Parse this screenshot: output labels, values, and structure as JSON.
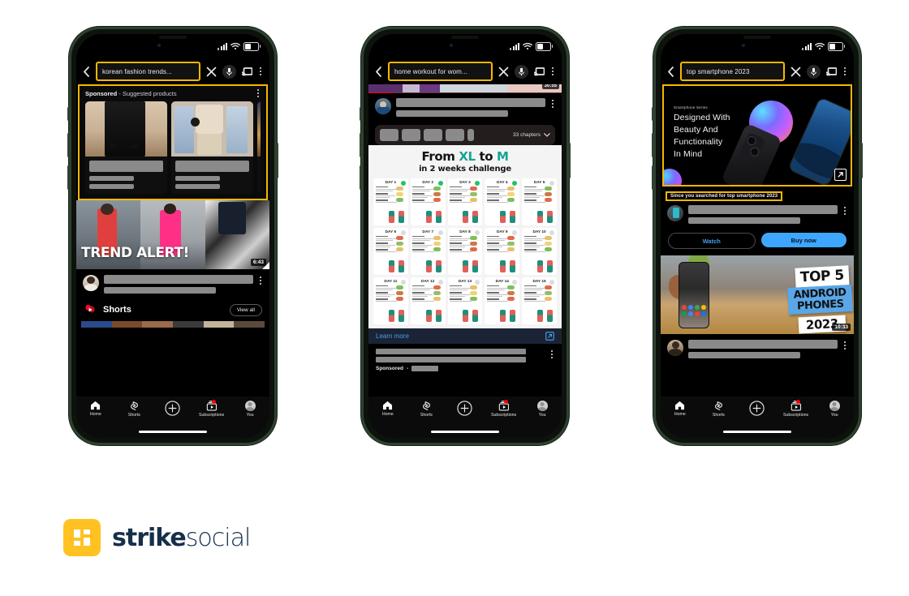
{
  "page": {
    "background": "#ffffff",
    "highlight_color": "#F5B800",
    "brand_navy": "#16304a",
    "brand_yellow": "#FFC222"
  },
  "brand": {
    "logo_mark": "strike-social-mark",
    "name_bold": "strike",
    "name_light": "social"
  },
  "phones": [
    {
      "id": "phone-korean-fashion",
      "status": {
        "signal": "signal-icon",
        "wifi": "wifi-icon",
        "battery": "battery-icon"
      },
      "search": {
        "query": "korean fashion trends...",
        "back_icon": "back-arrow-icon",
        "clear_icon": "close-icon",
        "mic_icon": "microphone-icon",
        "cast_icon": "cast-icon",
        "more_icon": "more-vertical-icon"
      },
      "sponsored": {
        "label": "Sponsored",
        "separator": "-",
        "subtitle": "Suggested products",
        "more_icon": "more-vertical-icon",
        "products": [
          {
            "alt": "black wide-leg pants outfit"
          },
          {
            "alt": "beige sweater and denim jeans set"
          },
          {
            "alt": "third product partially visible"
          }
        ]
      },
      "video": {
        "overlay_text": "TREND ALERT!",
        "duration": "6:43",
        "avatar": "channel-avatar",
        "more_icon": "more-vertical-icon"
      },
      "shorts": {
        "icon": "shorts-logo-icon",
        "title": "Shorts",
        "view_all": "View all"
      },
      "nav": [
        {
          "icon": "home-icon",
          "label": "Home"
        },
        {
          "icon": "shorts-icon",
          "label": "Shorts"
        },
        {
          "icon": "plus-circle-icon",
          "label": ""
        },
        {
          "icon": "subscriptions-icon",
          "label": "Subscriptions",
          "badge": true
        },
        {
          "icon": "account-avatar-icon",
          "label": "You"
        }
      ]
    },
    {
      "id": "phone-home-workout",
      "status": {
        "signal": "signal-icon",
        "wifi": "wifi-icon",
        "battery": "battery-icon"
      },
      "search": {
        "query": "home workout for wom...",
        "back_icon": "back-arrow-icon",
        "clear_icon": "close-icon",
        "mic_icon": "microphone-icon",
        "cast_icon": "cast-icon",
        "more_icon": "more-vertical-icon"
      },
      "player": {
        "duration": "30:55"
      },
      "video_meta": {
        "avatar": "channel-avatar",
        "more_icon": "more-vertical-icon"
      },
      "chapters": {
        "count_label": "33 chapters",
        "chevron": "chevron-down-icon"
      },
      "infographic": {
        "title_pre": "From ",
        "title_xl": "XL",
        "title_mid": " to ",
        "title_m": "M",
        "subtitle": "in 2 weeks challenge",
        "days": [
          {
            "label": "DAY 1",
            "done": true
          },
          {
            "label": "DAY 2",
            "done": true
          },
          {
            "label": "DAY 3",
            "done": true
          },
          {
            "label": "DAY 4",
            "done": true
          },
          {
            "label": "DAY 5",
            "done": false
          },
          {
            "label": "DAY 6",
            "done": false
          },
          {
            "label": "DAY 7",
            "done": false
          },
          {
            "label": "DAY 8",
            "done": false
          },
          {
            "label": "DAY 9",
            "done": false
          },
          {
            "label": "DAY 10",
            "done": false
          },
          {
            "label": "DAY 11",
            "done": false
          },
          {
            "label": "DAY 12",
            "done": false
          },
          {
            "label": "DAY 13",
            "done": false
          },
          {
            "label": "DAY 14",
            "done": false
          },
          {
            "label": "DAY 15",
            "done": false
          }
        ]
      },
      "learn_more": {
        "label": "Learn more",
        "icon": "external-link-icon"
      },
      "ad_meta": {
        "sponsored_label": "Sponsored",
        "separator": "-",
        "more_icon": "more-vertical-icon"
      },
      "nav": [
        {
          "icon": "home-icon",
          "label": "Home"
        },
        {
          "icon": "shorts-icon",
          "label": "Shorts"
        },
        {
          "icon": "plus-circle-icon",
          "label": ""
        },
        {
          "icon": "subscriptions-icon",
          "label": "Subscriptions",
          "badge": true
        },
        {
          "icon": "account-avatar-icon",
          "label": "You"
        }
      ]
    },
    {
      "id": "phone-top-smartphone",
      "status": {
        "signal": "signal-icon",
        "wifi": "wifi-icon",
        "battery": "battery-icon"
      },
      "search": {
        "query": "top smartphone 2023",
        "back_icon": "back-arrow-icon",
        "clear_icon": "close-icon",
        "mic_icon": "microphone-icon",
        "cast_icon": "cast-icon",
        "more_icon": "more-vertical-icon"
      },
      "masthead_ad": {
        "eyebrow": "Smartphone Series",
        "headline_lines": [
          "Designed With",
          "Beauty And",
          "Functionality",
          "In Mind"
        ],
        "popout_icon": "external-link-icon"
      },
      "since_searched": {
        "prefix": "Since you searched for ",
        "query": "top smartphone 2023"
      },
      "ad_meta": {
        "avatar": "advertiser-avatar",
        "more_icon": "more-vertical-icon"
      },
      "cta": {
        "secondary": "Watch",
        "primary": "Buy now"
      },
      "video": {
        "title_line1": "TOP 5",
        "title_line2a": "ANDROID",
        "title_line2b": "PHONES",
        "title_line3": "2023",
        "duration": "10:33",
        "avatar": "channel-avatar",
        "more_icon": "more-vertical-icon"
      },
      "nav": [
        {
          "icon": "home-icon",
          "label": "Home"
        },
        {
          "icon": "shorts-icon",
          "label": "Shorts"
        },
        {
          "icon": "plus-circle-icon",
          "label": ""
        },
        {
          "icon": "subscriptions-icon",
          "label": "Subscriptions",
          "badge": true
        },
        {
          "icon": "account-avatar-icon",
          "label": "You"
        }
      ]
    }
  ]
}
